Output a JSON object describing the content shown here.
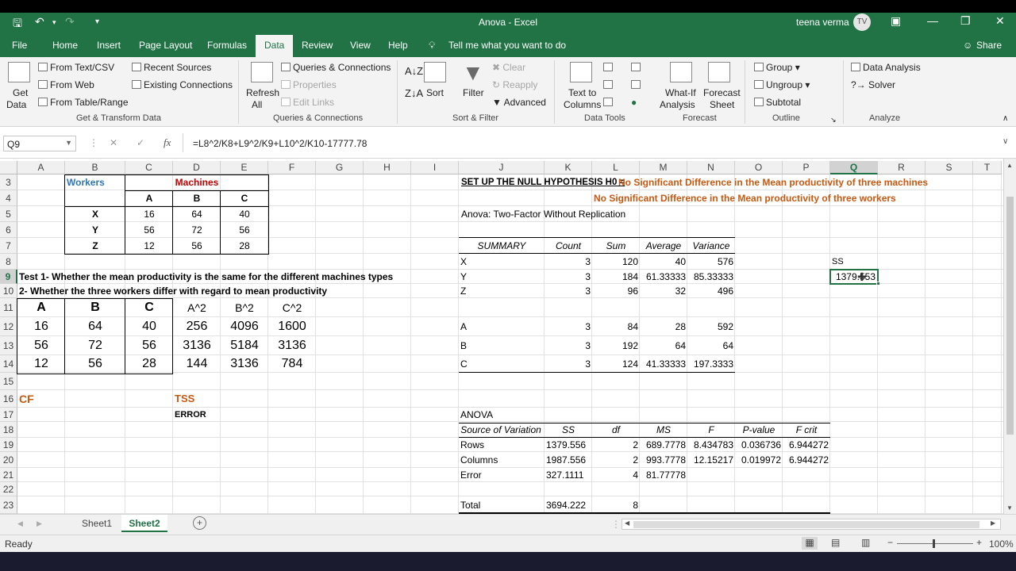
{
  "window": {
    "title": "Anova  -  Excel",
    "user": "teena verma",
    "avatar": "TV"
  },
  "tabs": [
    "File",
    "Home",
    "Insert",
    "Page Layout",
    "Formulas",
    "Data",
    "Review",
    "View",
    "Help"
  ],
  "tell_me": "Tell me what you want to do",
  "share": "Share",
  "ribbon": {
    "get_data": "Get",
    "get_data2": "Data",
    "from_text": "From Text/CSV",
    "from_web": "From Web",
    "from_table": "From Table/Range",
    "recent": "Recent Sources",
    "existing": "Existing Connections",
    "grp_get": "Get & Transform Data",
    "refresh": "Refresh",
    "refresh2": "All",
    "queries": "Queries & Connections",
    "properties": "Properties",
    "edit_links": "Edit Links",
    "grp_queries": "Queries & Connections",
    "sort": "Sort",
    "filter": "Filter",
    "clear": "Clear",
    "reapply": "Reapply",
    "advanced": "Advanced",
    "grp_sort": "Sort & Filter",
    "text_to_cols": "Text to",
    "text_to_cols2": "Columns",
    "grp_tools": "Data Tools",
    "whatif": "What-If",
    "whatif2": "Analysis",
    "forecast_sheet": "Forecast",
    "forecast_sheet2": "Sheet",
    "grp_forecast": "Forecast",
    "group": "Group",
    "ungroup": "Ungroup",
    "subtotal": "Subtotal",
    "grp_outline": "Outline",
    "data_analysis": "Data Analysis",
    "solver": "Solver",
    "grp_analyze": "Analyze"
  },
  "formula_bar": {
    "name_box": "Q9",
    "formula": "=L8^2/K8+L9^2/K9+L10^2/K10-17777.78"
  },
  "columns": [
    "A",
    "B",
    "C",
    "D",
    "E",
    "F",
    "G",
    "H",
    "I",
    "J",
    "K",
    "L",
    "M",
    "N",
    "O",
    "P",
    "Q",
    "R",
    "S",
    "T"
  ],
  "rows": [
    "3",
    "4",
    "5",
    "6",
    "7",
    "8",
    "9",
    "10",
    "11",
    "12",
    "13",
    "14",
    "15",
    "16",
    "17",
    "18",
    "19",
    "20",
    "21",
    "22",
    "23"
  ],
  "cells": {
    "workers": "Workers",
    "machines": "Machines",
    "mA": "A",
    "mB": "B",
    "mC": "C",
    "wX": "X",
    "wY": "Y",
    "wZ": "Z",
    "t1": [
      "16",
      "64",
      "40"
    ],
    "t2": [
      "56",
      "72",
      "56"
    ],
    "t3": [
      "12",
      "56",
      "28"
    ],
    "test1": "Test 1- Whether the mean productivity is the same for the different machines types",
    "test2": "2- Whether the three workers differ with regard to mean productivity",
    "sq_hdr": [
      "A",
      "B",
      "C",
      "A^2",
      "B^2",
      "C^2"
    ],
    "sq1": [
      "16",
      "64",
      "40",
      "256",
      "4096",
      "1600"
    ],
    "sq2": [
      "56",
      "72",
      "56",
      "3136",
      "5184",
      "3136"
    ],
    "sq3": [
      "12",
      "56",
      "28",
      "144",
      "3136",
      "784"
    ],
    "cf": "CF",
    "tss": "TSS",
    "error": "ERROR",
    "null_hyp": "SET UP THE NULL HYPOTHESIS H0 =",
    "null1": "No Significant Difference in the Mean productivity of three machines",
    "null2": "No Significant Difference in the Mean productivity of three workers",
    "anova_title": "Anova: Two-Factor Without Replication",
    "summary_hdr": [
      "SUMMARY",
      "Count",
      "Sum",
      "Average",
      "Variance"
    ],
    "summary": [
      [
        "X",
        "3",
        "120",
        "40",
        "576"
      ],
      [
        "Y",
        "3",
        "184",
        "61.33333",
        "85.33333"
      ],
      [
        "Z",
        "3",
        "96",
        "32",
        "496"
      ],
      [
        "A",
        "3",
        "84",
        "28",
        "592"
      ],
      [
        "B",
        "3",
        "192",
        "64",
        "64"
      ],
      [
        "C",
        "3",
        "124",
        "41.33333",
        "197.3333"
      ]
    ],
    "ss_label": "SS",
    "ss_value": "1379.553",
    "anova": "ANOVA",
    "anova_hdr": [
      "Source of Variation",
      "SS",
      "df",
      "MS",
      "F",
      "P-value",
      "F crit"
    ],
    "anova_rows": [
      [
        "Rows",
        "1379.556",
        "2",
        "689.7778",
        "8.434783",
        "0.036736",
        "6.944272"
      ],
      [
        "Columns",
        "1987.556",
        "2",
        "993.7778",
        "12.15217",
        "0.019972",
        "6.944272"
      ],
      [
        "Error",
        "327.1111",
        "4",
        "81.77778",
        "",
        "",
        ""
      ],
      [
        "Total",
        "3694.222",
        "8",
        "",
        "",
        "",
        ""
      ]
    ]
  },
  "sheets": [
    "Sheet1",
    "Sheet2"
  ],
  "status": {
    "ready": "Ready",
    "zoom": "100%"
  }
}
